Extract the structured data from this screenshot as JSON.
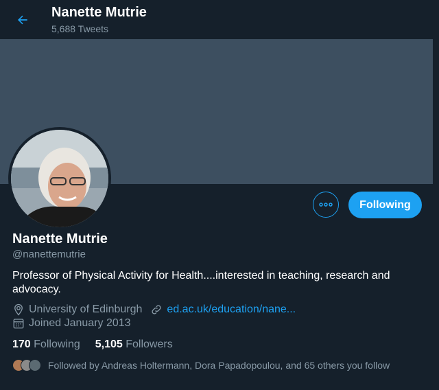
{
  "header": {
    "back_icon": "arrow-left-icon",
    "name": "Nanette Mutrie",
    "tweet_count": "5,688 Tweets"
  },
  "colors": {
    "background": "#15202b",
    "banner": "#3d4f60",
    "accent": "#1da1f2",
    "secondary_text": "#8899a6"
  },
  "profile": {
    "name": "Nanette Mutrie",
    "handle": "@nanettemutrie",
    "bio": "Professor of Physical Activity for Health....interested in teaching, research and advocacy.",
    "location": "University of Edinburgh",
    "location_icon": "location-pin-icon",
    "website": "ed.ac.uk/education/nane...",
    "website_icon": "link-icon",
    "joined": "Joined January 2013",
    "joined_icon": "calendar-icon"
  },
  "actions": {
    "more_icon": "more-dots-icon",
    "follow_label": "Following"
  },
  "stats": {
    "following_count": "170",
    "following_label": "Following",
    "followers_count": "5,105",
    "followers_label": "Followers"
  },
  "followed_by": {
    "text": "Followed by Andreas Holtermann, Dora Papadopoulou, and 65 others you follow"
  }
}
